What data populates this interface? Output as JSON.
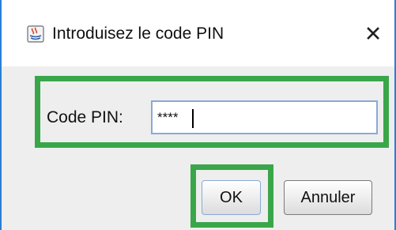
{
  "window": {
    "title": "Introduisez le code PIN",
    "close_glyph": "✕",
    "app_icon": "java-app-icon"
  },
  "form": {
    "pin_label": "Code PIN:",
    "pin_value": "****"
  },
  "buttons": {
    "ok_label": "OK",
    "cancel_label": "Annuler"
  },
  "colors": {
    "highlight": "#3aa64a",
    "window_border": "#2a7fd4",
    "input_border": "#8aa9d8",
    "content_background": "#eeeeee"
  }
}
